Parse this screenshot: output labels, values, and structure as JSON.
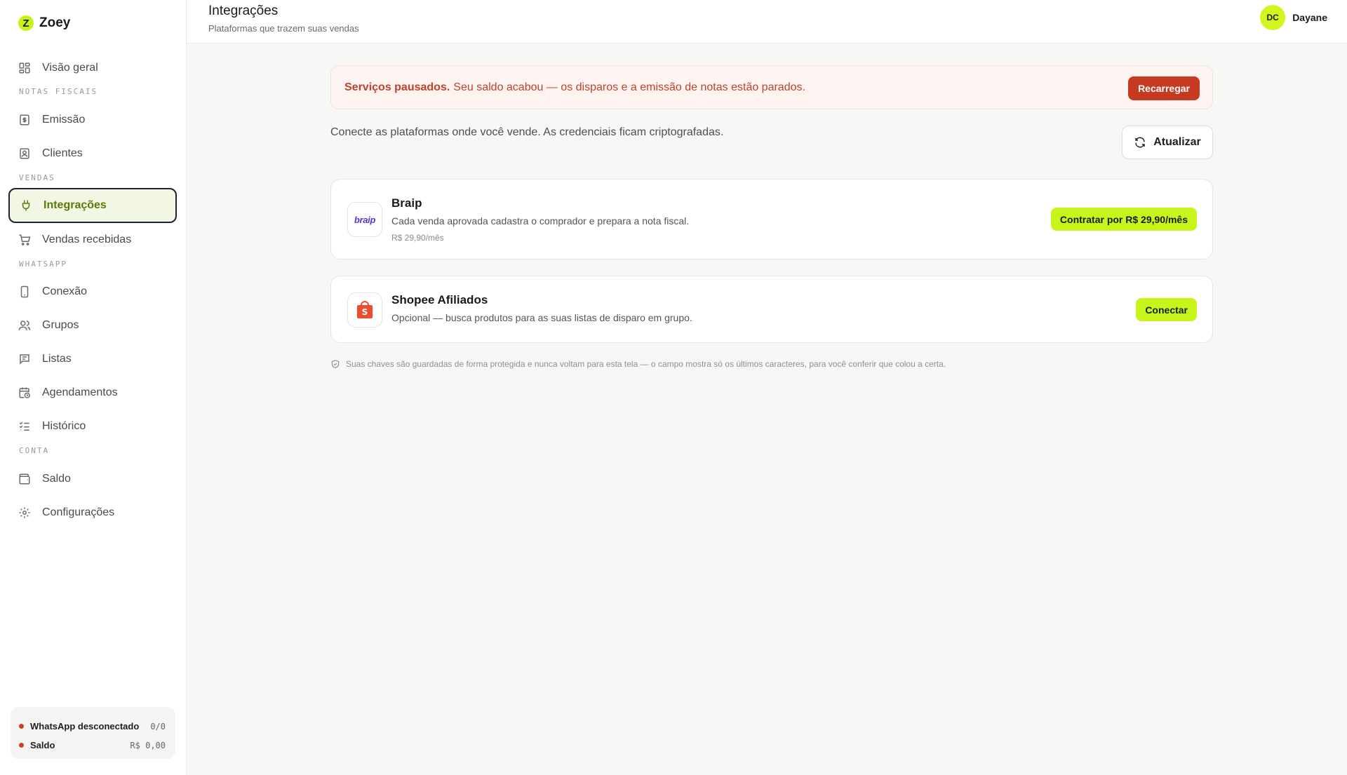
{
  "app": {
    "name": "Zoey",
    "logo_letter": "Z"
  },
  "header": {
    "title": "Integrações",
    "subtitle": "Plataformas que trazem suas vendas",
    "user": {
      "initials": "DC",
      "name": "Dayane"
    }
  },
  "sidebar": {
    "items": [
      {
        "label": "Visão geral",
        "icon": "grid-icon"
      },
      {
        "label": "Emissão",
        "icon": "invoice-icon"
      },
      {
        "label": "Clientes",
        "icon": "contact-icon"
      },
      {
        "label": "Integrações",
        "icon": "plug-icon",
        "active": true
      },
      {
        "label": "Vendas recebidas",
        "icon": "cart-icon"
      },
      {
        "label": "Conexão",
        "icon": "phone-icon"
      },
      {
        "label": "Grupos",
        "icon": "users-icon"
      },
      {
        "label": "Listas",
        "icon": "message-list-icon"
      },
      {
        "label": "Agendamentos",
        "icon": "calendar-clock-icon"
      },
      {
        "label": "Histórico",
        "icon": "checklist-icon"
      },
      {
        "label": "Saldo",
        "icon": "wallet-icon"
      },
      {
        "label": "Configurações",
        "icon": "gear-icon"
      }
    ],
    "sections": {
      "notas": "NOTAS FISCAIS",
      "vendas": "VENDAS",
      "whatsapp": "WHATSAPP",
      "conta": "CONTA"
    },
    "status": {
      "whatsapp_label": "WhatsApp desconectado",
      "whatsapp_value": "0/0",
      "saldo_label": "Saldo",
      "saldo_value": "R$ 0,00"
    }
  },
  "alert": {
    "strong": "Serviços pausados.",
    "text": "Seu saldo acabou — os disparos e a emissão de notas estão parados.",
    "button": "Recarregar"
  },
  "main": {
    "intro": "Conecte as plataformas onde você vende. As credenciais ficam criptografadas.",
    "refresh_button": "Atualizar",
    "integrations": [
      {
        "name": "Braip",
        "logo_text": "braip",
        "description": "Cada venda aprovada cadastra o comprador e prepara a nota fiscal.",
        "price": "R$ 29,90/mês",
        "button": "Contratar por R$ 29,90/mês"
      },
      {
        "name": "Shopee Afiliados",
        "logo_text": "S",
        "description": "Opcional — busca produtos para as suas listas de disparo em grupo.",
        "button": "Conectar"
      }
    ],
    "footnote": "Suas chaves são guardadas de forma protegida e nunca voltam para esta tela — o campo mostra só os últimos caracteres, para você conferir que colou a certa."
  },
  "colors": {
    "accent": "#c7f51b",
    "active_text": "#5a7a05",
    "alert_red": "#c73a22",
    "status_dot": "#d4401f",
    "braip_purple": "#5b35d1",
    "shopee_orange": "#ee4d2d"
  }
}
